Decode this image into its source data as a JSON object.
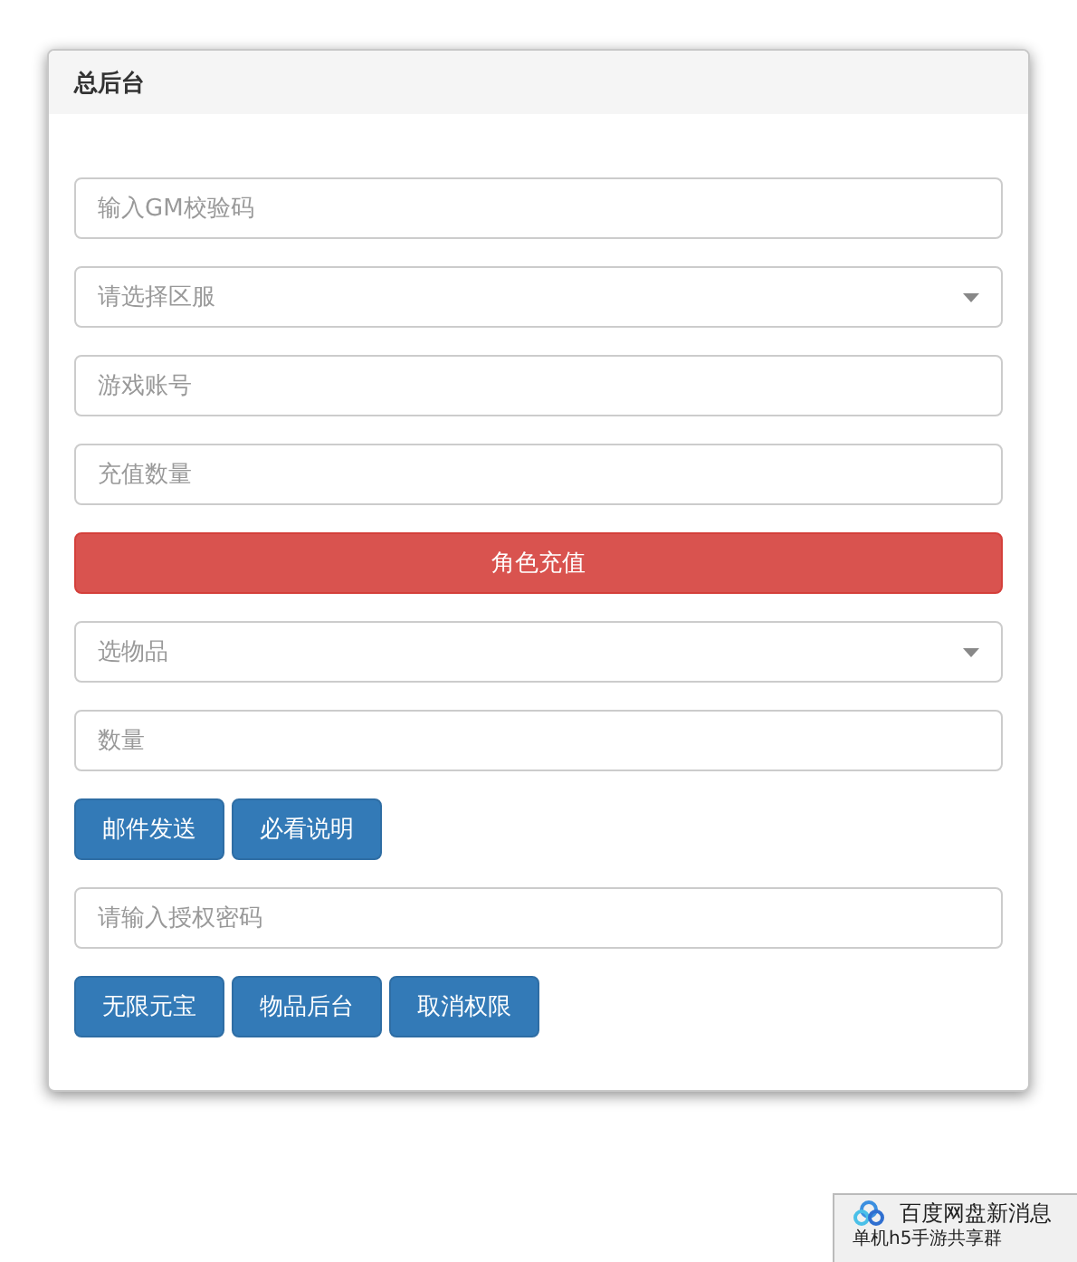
{
  "panel": {
    "title": "总后台",
    "items": [
      {
        "kind": "input",
        "placeholder": "输入GM校验码"
      },
      {
        "kind": "select",
        "placeholder": "请选择区服"
      },
      {
        "kind": "input",
        "placeholder": "游戏账号"
      },
      {
        "kind": "input",
        "placeholder": "充值数量"
      },
      {
        "kind": "wide-button",
        "label": "角色充值"
      },
      {
        "kind": "select",
        "placeholder": "选物品"
      },
      {
        "kind": "input",
        "placeholder": "数量"
      },
      {
        "kind": "buttons",
        "labels": [
          "邮件发送",
          "必看说明"
        ]
      },
      {
        "kind": "input",
        "placeholder": "请输入授权密码"
      },
      {
        "kind": "buttons",
        "labels": [
          "无限元宝",
          "物品后台",
          "取消权限"
        ]
      }
    ]
  },
  "notification": {
    "title": "百度网盘新消息",
    "text": "单机h5手游共享群"
  }
}
